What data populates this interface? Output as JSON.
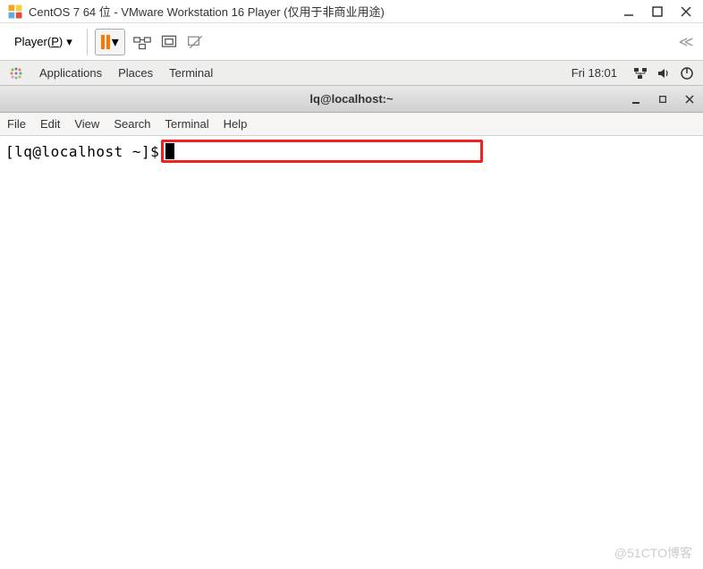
{
  "vmware": {
    "title": "CentOS 7 64 位 - VMware Workstation 16 Player (仅用于非商业用途)",
    "player_label_pre": "Player(",
    "player_label_u": "P",
    "player_label_post": ")"
  },
  "gnome": {
    "menus": [
      "Applications",
      "Places",
      "Terminal"
    ],
    "clock": "Fri 18:01"
  },
  "terminal": {
    "title": "lq@localhost:~",
    "menus": [
      "File",
      "Edit",
      "View",
      "Search",
      "Terminal",
      "Help"
    ],
    "prompt": "[lq@localhost ~]$"
  },
  "watermark": "@51CTO博客"
}
